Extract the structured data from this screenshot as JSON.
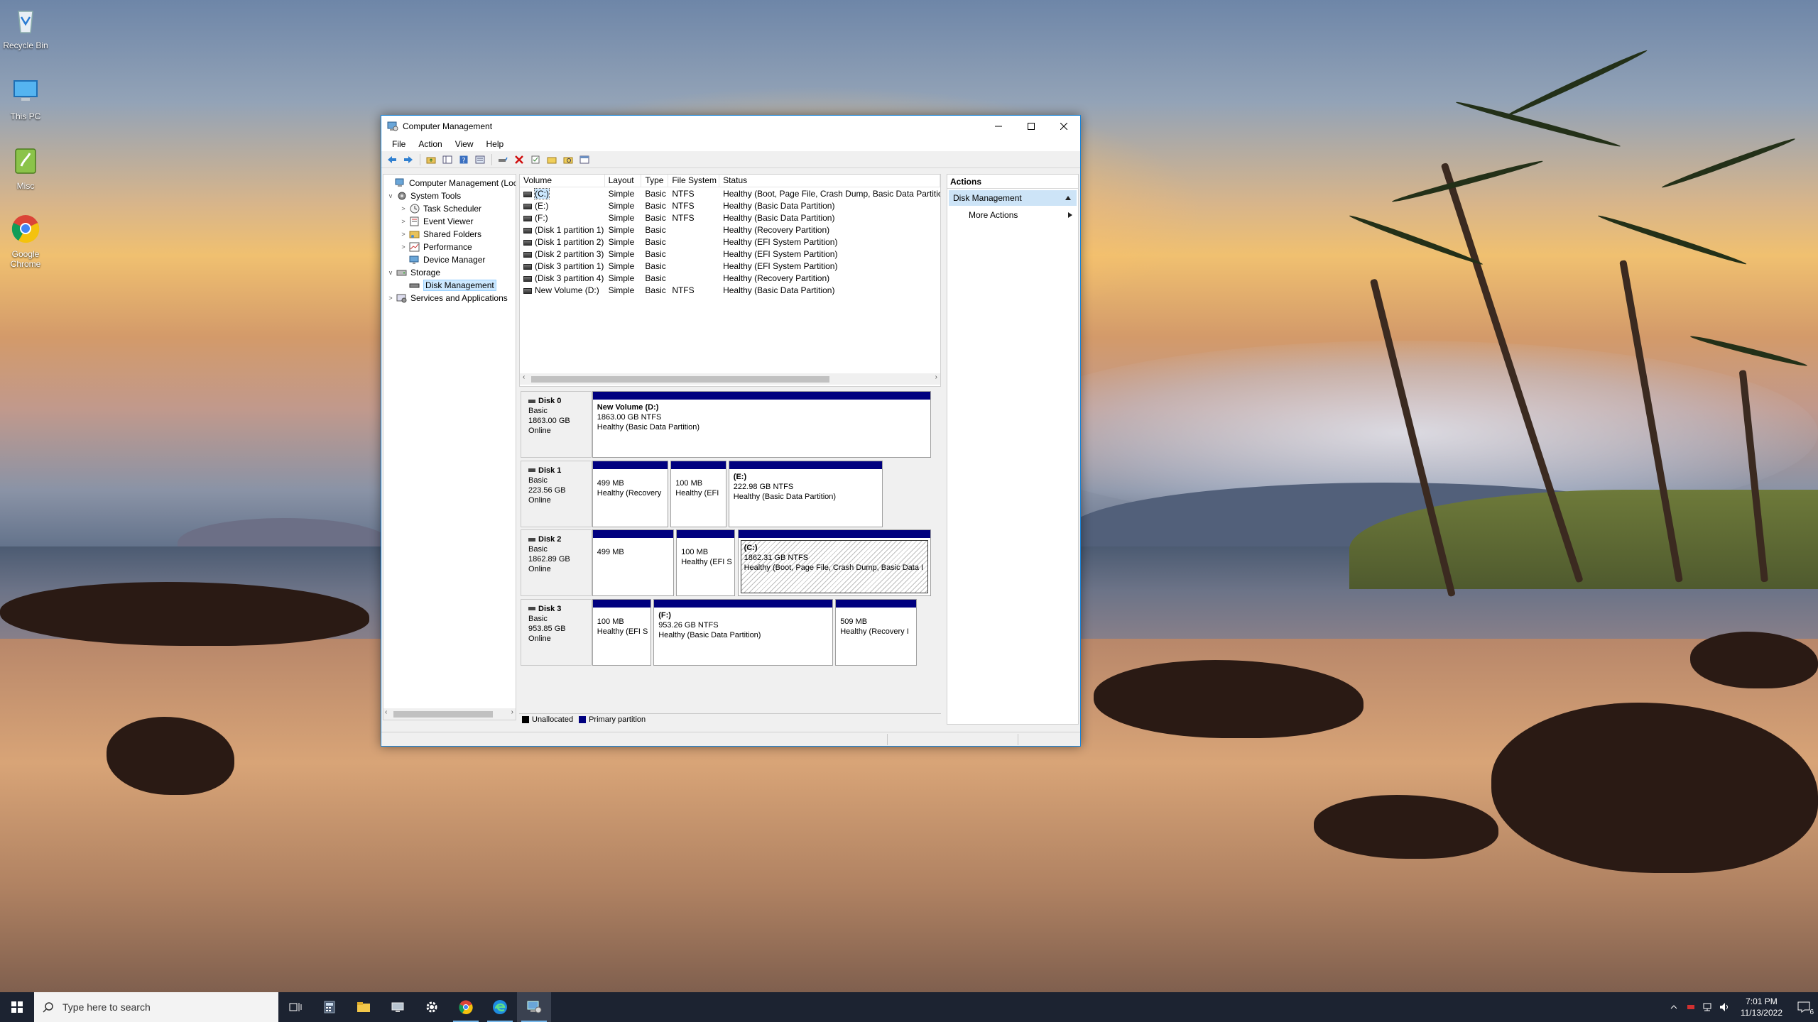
{
  "desktop": {
    "icons": [
      {
        "label": "Recycle Bin",
        "icon": "recycle-bin-icon"
      },
      {
        "label": "This PC",
        "icon": "this-pc-icon"
      },
      {
        "label": "Misc",
        "icon": "misc-icon"
      },
      {
        "label": "Google Chrome",
        "icon": "google-chrome-icon"
      }
    ]
  },
  "window": {
    "title": "Computer Management",
    "menu": [
      "File",
      "Action",
      "View",
      "Help"
    ]
  },
  "tree": {
    "items": [
      {
        "label": "Computer Management (Local",
        "expander": ""
      },
      {
        "label": "System Tools",
        "expander": "v"
      },
      {
        "label": "Task Scheduler",
        "expander": ">"
      },
      {
        "label": "Event Viewer",
        "expander": ">"
      },
      {
        "label": "Shared Folders",
        "expander": ">"
      },
      {
        "label": "Performance",
        "expander": ">"
      },
      {
        "label": "Device Manager",
        "expander": ""
      },
      {
        "label": "Storage",
        "expander": "v"
      },
      {
        "label": "Disk Management",
        "expander": ""
      },
      {
        "label": "Services and Applications",
        "expander": ">"
      }
    ]
  },
  "volumes": {
    "headers": [
      "Volume",
      "Layout",
      "Type",
      "File System",
      "Status"
    ],
    "rows": [
      {
        "volume": "(C:)",
        "layout": "Simple",
        "type": "Basic",
        "fs": "NTFS",
        "status": "Healthy (Boot, Page File, Crash Dump, Basic Data Partition)"
      },
      {
        "volume": "(E:)",
        "layout": "Simple",
        "type": "Basic",
        "fs": "NTFS",
        "status": "Healthy (Basic Data Partition)"
      },
      {
        "volume": "(F:)",
        "layout": "Simple",
        "type": "Basic",
        "fs": "NTFS",
        "status": "Healthy (Basic Data Partition)"
      },
      {
        "volume": "(Disk 1 partition 1)",
        "layout": "Simple",
        "type": "Basic",
        "fs": "",
        "status": "Healthy (Recovery Partition)"
      },
      {
        "volume": "(Disk 1 partition 2)",
        "layout": "Simple",
        "type": "Basic",
        "fs": "",
        "status": "Healthy (EFI System Partition)"
      },
      {
        "volume": "(Disk 2 partition 3)",
        "layout": "Simple",
        "type": "Basic",
        "fs": "",
        "status": "Healthy (EFI System Partition)"
      },
      {
        "volume": "(Disk 3 partition 1)",
        "layout": "Simple",
        "type": "Basic",
        "fs": "",
        "status": "Healthy (EFI System Partition)"
      },
      {
        "volume": "(Disk 3 partition 4)",
        "layout": "Simple",
        "type": "Basic",
        "fs": "",
        "status": "Healthy (Recovery Partition)"
      },
      {
        "volume": "New Volume (D:)",
        "layout": "Simple",
        "type": "Basic",
        "fs": "NTFS",
        "status": "Healthy (Basic Data Partition)"
      }
    ]
  },
  "disks": [
    {
      "name": "Disk 0",
      "type": "Basic",
      "size": "1863.00 GB",
      "state": "Online",
      "partitions": [
        {
          "label": "New Volume  (D:)",
          "size": "1863.00 GB NTFS",
          "status": "Healthy (Basic Data Partition)"
        }
      ]
    },
    {
      "name": "Disk 1",
      "type": "Basic",
      "size": "223.56 GB",
      "state": "Online",
      "partitions": [
        {
          "label": "",
          "size": "499 MB",
          "status": "Healthy (Recovery"
        },
        {
          "label": "",
          "size": "100 MB",
          "status": "Healthy (EFI"
        },
        {
          "label": "(E:)",
          "size": "222.98 GB NTFS",
          "status": "Healthy (Basic Data Partition)"
        }
      ]
    },
    {
      "name": "Disk 2",
      "type": "Basic",
      "size": "1862.89 GB",
      "state": "Online",
      "partitions": [
        {
          "label": "",
          "size": "499 MB",
          "status": ""
        },
        {
          "label": "",
          "size": "100 MB",
          "status": "Healthy (EFI S"
        },
        {
          "label": "(C:)",
          "size": "1862.31 GB NTFS",
          "status": "Healthy (Boot, Page File, Crash Dump, Basic Data I"
        }
      ]
    },
    {
      "name": "Disk 3",
      "type": "Basic",
      "size": "953.85 GB",
      "state": "Online",
      "partitions": [
        {
          "label": "",
          "size": "100 MB",
          "status": "Healthy (EFI S"
        },
        {
          "label": "(F:)",
          "size": "953.26 GB NTFS",
          "status": "Healthy (Basic Data Partition)"
        },
        {
          "label": "",
          "size": "509 MB",
          "status": "Healthy (Recovery I"
        }
      ]
    }
  ],
  "legend": {
    "unallocated": "Unallocated",
    "primary": "Primary partition",
    "unallocated_color": "#000000",
    "primary_color": "#00007f"
  },
  "actions": {
    "header": "Actions",
    "section": "Disk Management",
    "more": "More Actions"
  },
  "taskbar": {
    "search_placeholder": "Type here to search",
    "time": "7:01 PM",
    "date": "11/13/2022",
    "notification_count": "6"
  }
}
